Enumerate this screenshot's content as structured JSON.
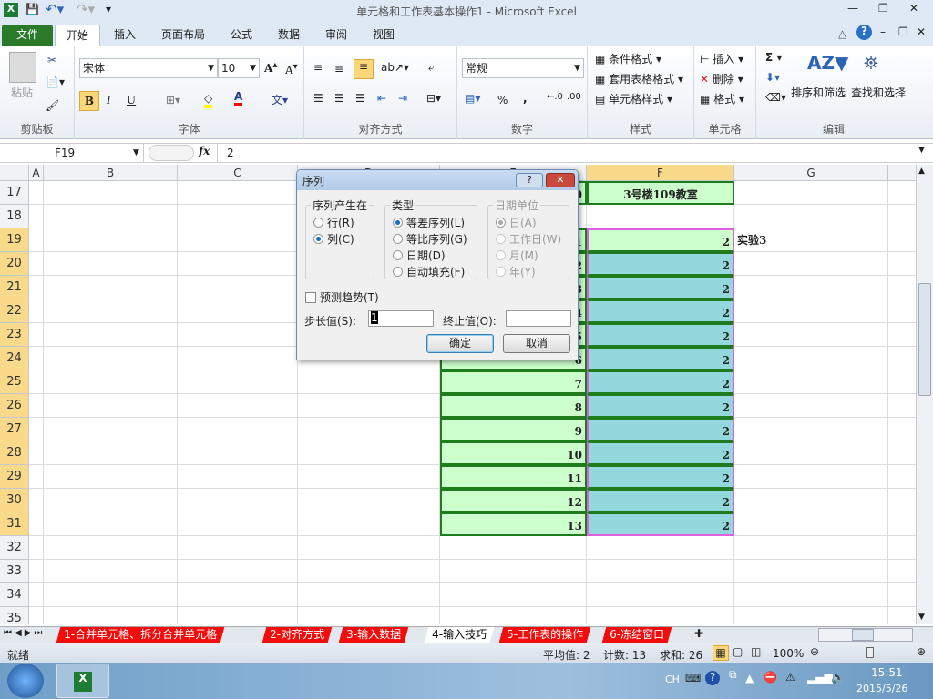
{
  "window": {
    "title": "单元格和工作表基本操作1 - Microsoft Excel"
  },
  "ribbon_tabs": [
    "文件",
    "开始",
    "插入",
    "页面布局",
    "公式",
    "数据",
    "审阅",
    "视图"
  ],
  "clipboard": {
    "paste": "粘贴",
    "label": "剪贴板"
  },
  "font": {
    "name": "宋体",
    "size": "10",
    "bold": "B",
    "italic": "I",
    "underline": "U",
    "label": "字体",
    "font_color": "#ff0000",
    "fill_color": "#ffff00"
  },
  "alignment": {
    "label": "对齐方式"
  },
  "number": {
    "format": "常规",
    "percent": "%",
    "comma": ",",
    "label": "数字"
  },
  "styles": {
    "items": [
      "条件格式",
      "套用表格格式",
      "单元格样式"
    ],
    "label": "样式"
  },
  "cells": {
    "items": [
      "插入",
      "删除",
      "格式"
    ],
    "label": "单元格"
  },
  "editing": {
    "sum": "Σ",
    "sort": "排序和筛选",
    "find": "查找和选择",
    "label": "编辑"
  },
  "formula_bar": {
    "name_box": "F19",
    "fx": "fx",
    "value": "2"
  },
  "columns": [
    "A",
    "B",
    "C",
    "D",
    "E",
    "F",
    "G"
  ],
  "rows": [
    {
      "n": "17",
      "E": "0",
      "F": "3号楼109教室",
      "G": ""
    },
    {
      "n": "18",
      "E": "",
      "F": "",
      "G": ""
    },
    {
      "n": "19",
      "E": "1",
      "F": "2",
      "G": "实验3"
    },
    {
      "n": "20",
      "E": "2",
      "F": "2",
      "G": ""
    },
    {
      "n": "21",
      "E": "3",
      "F": "2",
      "G": ""
    },
    {
      "n": "22",
      "E": "4",
      "F": "2",
      "G": ""
    },
    {
      "n": "23",
      "E": "5",
      "F": "2",
      "G": ""
    },
    {
      "n": "24",
      "E": "6",
      "F": "2",
      "G": ""
    },
    {
      "n": "25",
      "E": "7",
      "F": "2",
      "G": ""
    },
    {
      "n": "26",
      "E": "8",
      "F": "2",
      "G": ""
    },
    {
      "n": "27",
      "E": "9",
      "F": "2",
      "G": ""
    },
    {
      "n": "28",
      "E": "10",
      "F": "2",
      "G": ""
    },
    {
      "n": "29",
      "E": "11",
      "F": "2",
      "G": ""
    },
    {
      "n": "30",
      "E": "12",
      "F": "2",
      "G": ""
    },
    {
      "n": "31",
      "E": "13",
      "F": "2",
      "G": ""
    },
    {
      "n": "32",
      "E": "",
      "F": "",
      "G": ""
    },
    {
      "n": "33",
      "E": "",
      "F": "",
      "G": ""
    },
    {
      "n": "34",
      "E": "",
      "F": "",
      "G": ""
    },
    {
      "n": "35",
      "E": "",
      "F": "",
      "G": ""
    }
  ],
  "dialog": {
    "title": "序列",
    "help": "?",
    "close": "✕",
    "series_in": {
      "label": "序列产生在",
      "options": [
        "行(R)",
        "列(C)"
      ],
      "selected": 1
    },
    "type": {
      "label": "类型",
      "options": [
        "等差序列(L)",
        "等比序列(G)",
        "日期(D)",
        "自动填充(F)"
      ],
      "selected": 0
    },
    "date_unit": {
      "label": "日期单位",
      "options": [
        "日(A)",
        "工作日(W)",
        "月(M)",
        "年(Y)"
      ],
      "selected": 0,
      "disabled": true
    },
    "trend": {
      "label": "预测趋势(T)",
      "checked": false
    },
    "step": {
      "label": "步长值(S):",
      "value": "1"
    },
    "stop": {
      "label": "终止值(O):",
      "value": ""
    },
    "ok": "确定",
    "cancel": "取消"
  },
  "sheet_tabs": [
    "1-合并单元格、拆分合并单元格",
    "2-对齐方式",
    "3-输入数据",
    "4-输入技巧",
    "5-工作表的操作",
    "6-冻结窗口"
  ],
  "active_sheet": 3,
  "status": {
    "ready": "就绪",
    "average": "平均值: 2",
    "count": "计数: 13",
    "sum": "求和: 26",
    "zoom": "100%"
  },
  "taskbar": {
    "lang": "CH",
    "time": "15:51",
    "date": "2015/5/26"
  }
}
